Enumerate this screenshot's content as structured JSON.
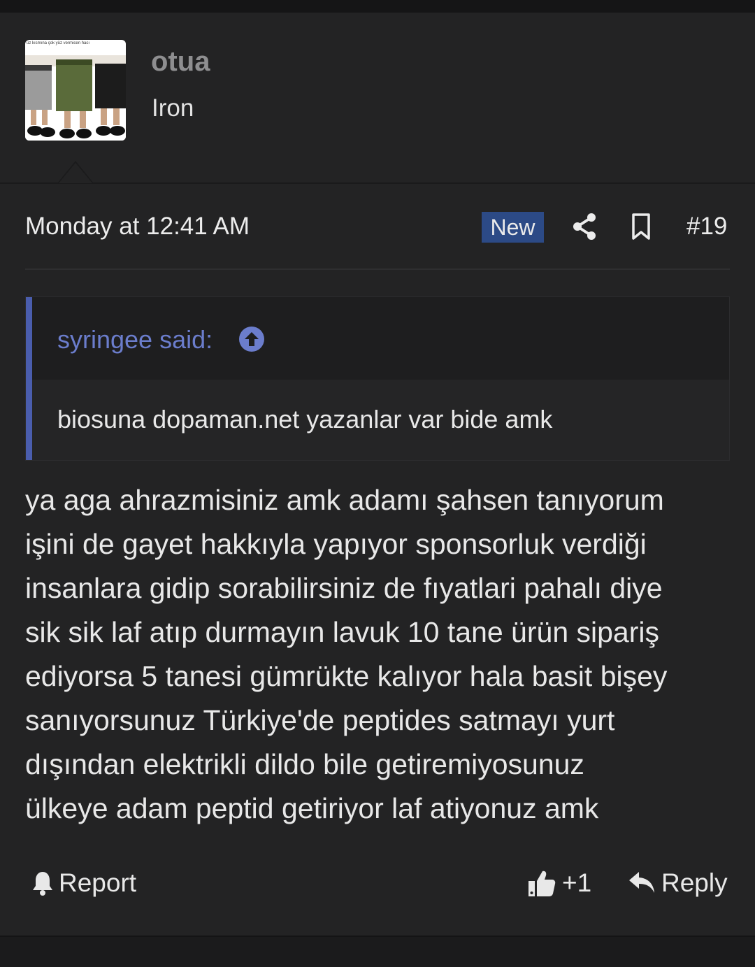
{
  "user": {
    "avatar_caption": "üz kısmına çok yüz vermicen hacı",
    "username": "otua",
    "title": "Iron"
  },
  "meta": {
    "timestamp": "Monday at 12:41 AM",
    "new_badge": "New",
    "post_number": "#19",
    "share_icon": "share-icon",
    "bookmark_icon": "bookmark-icon"
  },
  "quote": {
    "author": "syringee said:",
    "text": "biosuna dopaman.net yazanlar var bide amk",
    "jump_icon": "arrow-up-circle-icon",
    "accent": "#4a5dad"
  },
  "message": {
    "lines": [
      "ya aga ahrazmisiniz amk adamı şahsen tanıyorum",
      "işini de gayet hakkıyla yapıyor sponsorluk verdiği",
      "insanlara gidip sorabilirsiniz de fıyatlari pahalı diye",
      "sik sik laf atıp durmayın lavuk 10 tane ürün sipariş",
      "ediyorsa 5 tanesi gümrükte kalıyor hala basit bişey",
      "sanıyorsunuz Türkiye'de peptides satmayı yurt",
      "dışından elektrikli dildo bile getiremiyosunuz",
      "ülkeye adam peptid getiriyor laf atiyonuz amk"
    ]
  },
  "actions": {
    "report_label": "Report",
    "like_label": "+1",
    "reply_label": "Reply"
  },
  "colors": {
    "badge": "#2c4a86",
    "quote_author": "#6b7dcc"
  }
}
